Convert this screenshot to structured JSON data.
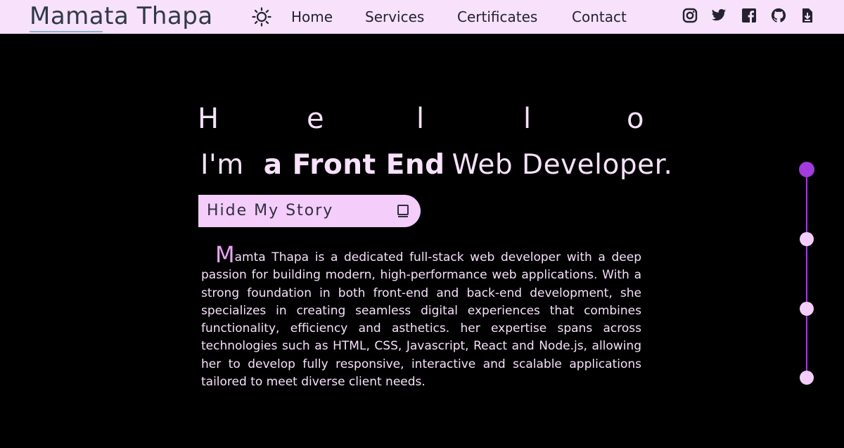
{
  "header": {
    "logo": "Mamata Thapa",
    "nav": [
      {
        "label": "Home"
      },
      {
        "label": "Services"
      },
      {
        "label": "Certificates"
      },
      {
        "label": "Contact"
      }
    ],
    "social": [
      "instagram-icon",
      "twitter-icon",
      "facebook-icon",
      "github-icon",
      "download-icon"
    ]
  },
  "hero": {
    "hello_letters": [
      "H",
      "e",
      "l",
      "l",
      "o"
    ],
    "role_prefix": "I'm",
    "role_strong": "a Front End",
    "role_rest": "Web Developer."
  },
  "story_button": {
    "label": "Hide My Story",
    "icon": "book-icon"
  },
  "story": {
    "dropcap": "M",
    "text": "amta Thapa is a dedicated full-stack web developer with a deep passion for building modern, high-performance web applications. With a strong foundation in both front-end and back-end development, she specializes in creating seamless digital experiences that combines functionality, efficiency and asthetics. her expertise spans across technologies such as HTML, CSS, Javascript, React and Node.js, allowing her to develop fully responsive, interactive and scalable applications tailored to meet diverse client needs."
  },
  "section_indicator": {
    "count": 4,
    "active_index": 0
  },
  "colors": {
    "header_bg": "#f7e1fb",
    "page_bg": "#000000",
    "text_light": "#f7e1fb",
    "accent": "#a33be0",
    "button_bg": "#f4cdfb"
  }
}
